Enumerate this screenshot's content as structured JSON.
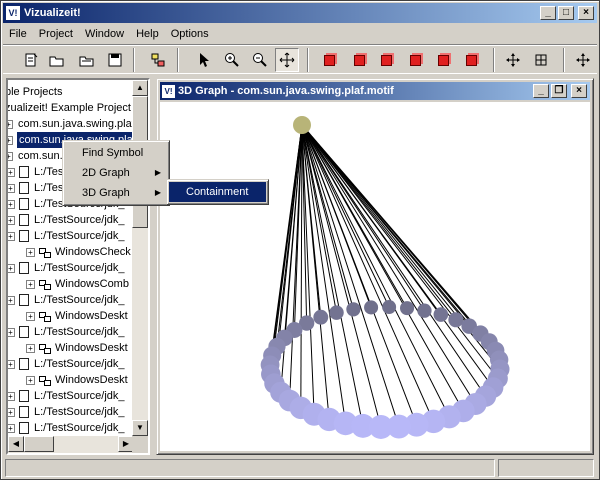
{
  "app": {
    "title": "Vizualizeit!",
    "icon_text": "V!"
  },
  "menubar": [
    {
      "label": "File",
      "key": "F"
    },
    {
      "label": "Project",
      "key": "P"
    },
    {
      "label": "Window",
      "key": "W"
    },
    {
      "label": "Help",
      "key": "H"
    },
    {
      "label": "Options",
      "key": "O"
    }
  ],
  "toolbar": {
    "buttons": [
      "new-project-icon",
      "open-folder-icon",
      "open-folder-alt-icon",
      "save-icon",
      "graph-layout-icon",
      "pointer-icon",
      "zoom-in-icon",
      "zoom-out-icon",
      "move-icon",
      "cube-front-icon",
      "cube-right-icon",
      "cube-left-icon",
      "cube-back-icon",
      "cube-top-icon",
      "cube-bottom-icon",
      "pan-icon",
      "fit-icon",
      "navigate-icon"
    ]
  },
  "tree": {
    "items": [
      {
        "label": "ble Projects",
        "type": "text",
        "indent": 0
      },
      {
        "label": "zualizeit! Example Project",
        "type": "text",
        "indent": 0
      },
      {
        "label": "com.sun.java.swing.plaf",
        "type": "pkg",
        "indent": 0
      },
      {
        "label": "com.sun.java.swing.plaf",
        "type": "pkg",
        "indent": 0,
        "selected": true
      },
      {
        "label": "com.sun.java.swing.plaf",
        "type": "pkg",
        "indent": 0
      },
      {
        "label": "L:/TestSource/jdk_",
        "type": "file",
        "indent": 1
      },
      {
        "label": "L:/TestSource/jdk_",
        "type": "file",
        "indent": 1
      },
      {
        "label": "L:/TestSource/jdk_",
        "type": "file",
        "indent": 1
      },
      {
        "label": "L:/TestSource/jdk_",
        "type": "file",
        "indent": 1
      },
      {
        "label": "L:/TestSource/jdk_",
        "type": "file",
        "indent": 1
      },
      {
        "label": "WindowsCheck",
        "type": "class",
        "indent": 2
      },
      {
        "label": "L:/TestSource/jdk_",
        "type": "file",
        "indent": 1
      },
      {
        "label": "WindowsComb",
        "type": "class",
        "indent": 2
      },
      {
        "label": "L:/TestSource/jdk_",
        "type": "file",
        "indent": 1
      },
      {
        "label": "WindowsDeskt",
        "type": "class",
        "indent": 2
      },
      {
        "label": "L:/TestSource/jdk_",
        "type": "file",
        "indent": 1
      },
      {
        "label": "WindowsDeskt",
        "type": "class",
        "indent": 2
      },
      {
        "label": "L:/TestSource/jdk_",
        "type": "file",
        "indent": 1
      },
      {
        "label": "WindowsDeskt",
        "type": "class",
        "indent": 2
      },
      {
        "label": "L:/TestSource/jdk_",
        "type": "file",
        "indent": 1
      },
      {
        "label": "L:/TestSource/jdk_",
        "type": "file",
        "indent": 1
      },
      {
        "label": "L:/TestSource/jdk_",
        "type": "file",
        "indent": 1
      }
    ]
  },
  "context_menu": {
    "items": [
      {
        "label": "Find Symbol",
        "submenu": false
      },
      {
        "label": "2D Graph",
        "submenu": true
      },
      {
        "label": "3D Graph",
        "submenu": true,
        "highlighted": true
      }
    ],
    "submenu": {
      "items": [
        {
          "label": "Containment",
          "active": true
        }
      ]
    }
  },
  "graph_window": {
    "title": "3D Graph - com.sun.java.swing.plaf.motif",
    "icon_text": "V!",
    "root_color": "#b8b478",
    "node_color_near": "#b8b8f8",
    "node_color_far": "#70708c",
    "node_count": 40
  },
  "colors": {
    "selection": "#0a246a",
    "face": "#d4d0c8",
    "title_gradient_end": "#a6caf0"
  }
}
